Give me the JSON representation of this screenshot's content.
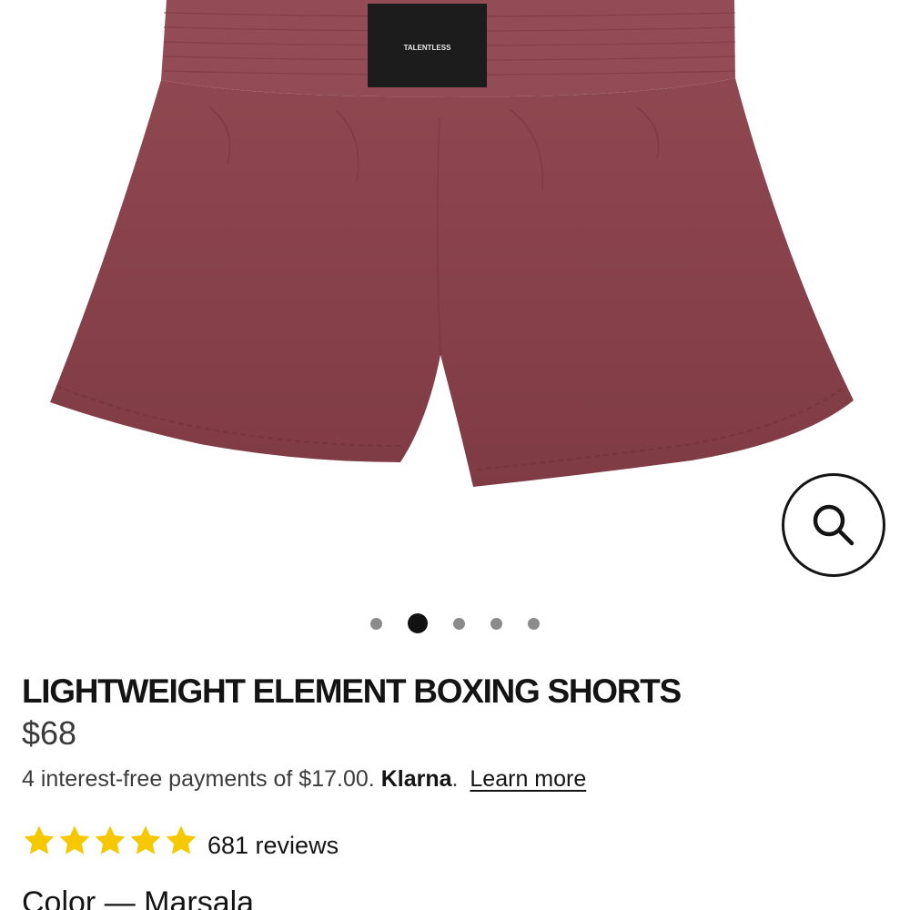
{
  "product": {
    "image_alt": "Marsala lightweight boxing shorts",
    "label_text": "TALENTLESS",
    "title": "LIGHTWEIGHT ELEMENT BOXING SHORTS",
    "price": "$68",
    "rating": 5,
    "reviews_text": "681 reviews",
    "color_line": "Color — Marsala"
  },
  "gallery": {
    "dot_count": 5,
    "active_index": 1
  },
  "payment": {
    "installments_text": "4 interest-free payments of $17.00.",
    "brand": "Klarna",
    "brand_suffix": ".",
    "learn_more_label": "Learn more"
  },
  "icons": {
    "zoom": "search-icon",
    "rating": "star-icon"
  },
  "colors": {
    "fabric": "#8a3f48",
    "star": "#f5c800",
    "text": "#141414",
    "dot_active": "#111111",
    "dot_inactive": "#8b8b8b"
  }
}
